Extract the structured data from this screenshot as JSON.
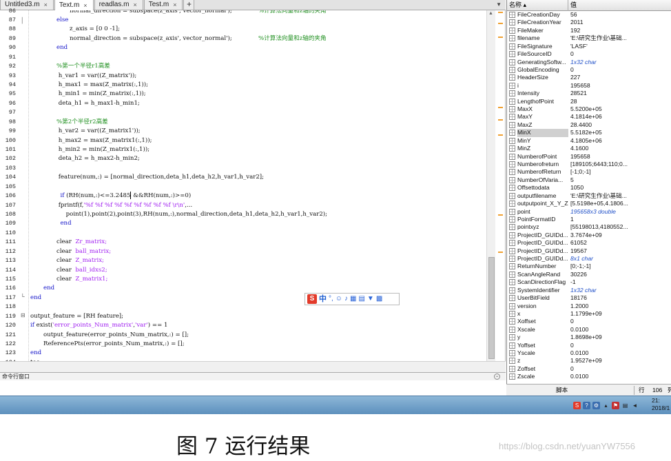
{
  "editor": {
    "tabs": [
      {
        "label": "Untitled3.m",
        "active": false
      },
      {
        "label": "Text.m",
        "active": true
      },
      {
        "label": "readlas.m",
        "active": false
      },
      {
        "label": "Test.m",
        "active": false
      }
    ],
    "tab_close": "×",
    "tab_add": "+",
    "lines": [
      {
        "n": "86",
        "indent": 3,
        "parts": [
          {
            "t": "normal_direction = subspace(z_axis', vector_normal');",
            "c": ""
          },
          {
            "t": "              %计算法向量和z轴的夹角",
            "c": "cm"
          }
        ]
      },
      {
        "n": "87",
        "indent": 2,
        "parts": [
          {
            "t": "else",
            "c": "kw"
          }
        ]
      },
      {
        "n": "88",
        "indent": 3,
        "parts": [
          {
            "t": "z_axis = [0 0 -1];",
            "c": ""
          }
        ]
      },
      {
        "n": "89",
        "indent": 3,
        "parts": [
          {
            "t": "normal_direction = subspace(z_axis', vector_normal');",
            "c": ""
          },
          {
            "t": "              %计算法向量和z轴的夹角",
            "c": "cm"
          }
        ]
      },
      {
        "n": "90",
        "indent": 2,
        "parts": [
          {
            "t": "end",
            "c": "kw"
          }
        ]
      },
      {
        "n": "91",
        "indent": 0,
        "parts": []
      },
      {
        "n": "92",
        "indent": 2,
        "parts": [
          {
            "t": "%第一个半径r1高差",
            "c": "cm"
          }
        ]
      },
      {
        "n": "93",
        "indent": 2,
        "parts": [
          {
            "t": " h_var1 = var((Z_matrix'));",
            "c": ""
          }
        ]
      },
      {
        "n": "94",
        "indent": 2,
        "parts": [
          {
            "t": " h_max1 = max(Z_matrix(:,1));",
            "c": ""
          }
        ]
      },
      {
        "n": "95",
        "indent": 2,
        "parts": [
          {
            "t": " h_min1 = min(Z_matrix(:,1));",
            "c": ""
          }
        ]
      },
      {
        "n": "96",
        "indent": 2,
        "parts": [
          {
            "t": " deta_h1 = h_max1-h_min1;",
            "c": ""
          }
        ]
      },
      {
        "n": "97",
        "indent": 0,
        "parts": []
      },
      {
        "n": "98",
        "indent": 2,
        "parts": [
          {
            "t": "%第2个半径r2高差",
            "c": "cm"
          }
        ]
      },
      {
        "n": "99",
        "indent": 2,
        "parts": [
          {
            "t": " h_var2 = var((Z_matrix1'));",
            "c": ""
          }
        ]
      },
      {
        "n": "100",
        "indent": 2,
        "parts": [
          {
            "t": " h_max2 = max(Z_matrix1(:,1));",
            "c": ""
          }
        ]
      },
      {
        "n": "101",
        "indent": 2,
        "parts": [
          {
            "t": " h_min2 = min(Z_matrix1(:,1));",
            "c": ""
          }
        ]
      },
      {
        "n": "102",
        "indent": 2,
        "parts": [
          {
            "t": " deta_h2 = h_max2-h_min2;",
            "c": ""
          }
        ]
      },
      {
        "n": "103",
        "indent": 0,
        "parts": []
      },
      {
        "n": "104",
        "indent": 2,
        "parts": [
          {
            "t": " feature(num,:) = [normal_direction,deta_h1,deta_h2,h_var1,h_var2];",
            "c": ""
          }
        ]
      },
      {
        "n": "105",
        "indent": 0,
        "parts": []
      },
      {
        "n": "106",
        "indent": 2,
        "parts": [
          {
            "t": "  ",
            "c": ""
          },
          {
            "t": "if",
            "c": "kw"
          },
          {
            "t": " (RH(num,:)<=3.2485",
            "c": ""
          },
          {
            "t": "|",
            "c": "cursor"
          },
          {
            "t": " &&RH(num,:)>=0)",
            "c": ""
          }
        ]
      },
      {
        "n": "107",
        "indent": 2,
        "parts": [
          {
            "t": " fprintf(f,",
            "c": ""
          },
          {
            "t": "'%f %f %f %f %f %f %f %f %f \\r\\n'",
            "c": "str"
          },
          {
            "t": ",...",
            "c": ""
          }
        ]
      },
      {
        "n": "108",
        "indent": 2,
        "parts": [
          {
            "t": "     point(1),point(2),point(3),RH(num,:),normal_direction,deta_h1,deta_h2,h_var1,h_var2);",
            "c": ""
          }
        ]
      },
      {
        "n": "109",
        "indent": 2,
        "parts": [
          {
            "t": "  ",
            "c": ""
          },
          {
            "t": "end",
            "c": "kw"
          }
        ]
      },
      {
        "n": "110",
        "indent": 0,
        "parts": []
      },
      {
        "n": "111",
        "indent": 2,
        "parts": [
          {
            "t": "clear  ",
            "c": ""
          },
          {
            "t": "Zr_matrix;",
            "c": "str"
          }
        ]
      },
      {
        "n": "112",
        "indent": 2,
        "parts": [
          {
            "t": "clear  ",
            "c": ""
          },
          {
            "t": "ball_matrix;",
            "c": "str"
          }
        ]
      },
      {
        "n": "113",
        "indent": 2,
        "parts": [
          {
            "t": "clear  ",
            "c": ""
          },
          {
            "t": "Z_matrix;",
            "c": "str"
          }
        ]
      },
      {
        "n": "114",
        "indent": 2,
        "parts": [
          {
            "t": "clear  ",
            "c": ""
          },
          {
            "t": "ball_idxs2;",
            "c": "str"
          }
        ]
      },
      {
        "n": "115",
        "indent": 2,
        "parts": [
          {
            "t": "clear  ",
            "c": ""
          },
          {
            "t": "Z_matrix1;",
            "c": "str"
          }
        ]
      },
      {
        "n": "116",
        "indent": 1,
        "parts": [
          {
            "t": "end",
            "c": "kw"
          }
        ]
      },
      {
        "n": "117",
        "indent": 0,
        "parts": [
          {
            "t": "end",
            "c": "kw"
          }
        ]
      },
      {
        "n": "118",
        "indent": 0,
        "parts": []
      },
      {
        "n": "119",
        "indent": 0,
        "parts": [
          {
            "t": "output_feature = [RH feature];",
            "c": ""
          }
        ]
      },
      {
        "n": "120",
        "indent": 0,
        "parts": [
          {
            "t": "if",
            "c": "kw"
          },
          {
            "t": " exist(",
            "c": ""
          },
          {
            "t": "'error_points_Num_matrix'",
            "c": "str"
          },
          {
            "t": ",",
            "c": ""
          },
          {
            "t": "'var'",
            "c": "str"
          },
          {
            "t": ") == 1",
            "c": ""
          }
        ]
      },
      {
        "n": "121",
        "indent": 1,
        "parts": [
          {
            "t": "output_feature(error_points_Num_matrix,:) = [];",
            "c": ""
          }
        ]
      },
      {
        "n": "122",
        "indent": 1,
        "parts": [
          {
            "t": "ReferencePts(error_points_Num_matrix,:) = [];",
            "c": ""
          }
        ]
      },
      {
        "n": "123",
        "indent": 0,
        "parts": [
          {
            "t": "end",
            "c": "kw"
          }
        ]
      },
      {
        "n": "124",
        "indent": 0,
        "parts": [
          {
            "t": "toc;",
            "c": ""
          }
        ]
      }
    ]
  },
  "command_window": {
    "title": "命令行窗口"
  },
  "ime": {
    "logo": "S",
    "mode": "中"
  },
  "workspace": {
    "header_name": "名称 ▴",
    "header_value": "值",
    "rows": [
      {
        "name": "FileCreationDay",
        "value": "56",
        "italic": false
      },
      {
        "name": "FileCreationYear",
        "value": "2011",
        "italic": false
      },
      {
        "name": "FileMaker",
        "value": "192",
        "italic": false
      },
      {
        "name": "filename",
        "value": "'E:\\研究生作业\\基础...",
        "italic": false
      },
      {
        "name": "FileSignature",
        "value": "'LASF'",
        "italic": false
      },
      {
        "name": "FileSourceID",
        "value": "0",
        "italic": false
      },
      {
        "name": "GeneratingSoftw...",
        "value": "1x32 char",
        "italic": true
      },
      {
        "name": "GlobalEncoding",
        "value": "0",
        "italic": false
      },
      {
        "name": "HeaderSize",
        "value": "227",
        "italic": false
      },
      {
        "name": "i",
        "value": "195658",
        "italic": false
      },
      {
        "name": "Intensity",
        "value": "28521",
        "italic": false
      },
      {
        "name": "LengthofPoint",
        "value": "28",
        "italic": false
      },
      {
        "name": "MaxX",
        "value": "5.5200e+05",
        "italic": false
      },
      {
        "name": "MaxY",
        "value": "4.1814e+06",
        "italic": false
      },
      {
        "name": "MaxZ",
        "value": "28.4400",
        "italic": false
      },
      {
        "name": "MinX",
        "value": "5.5182e+05",
        "italic": false,
        "selected": true
      },
      {
        "name": "MinY",
        "value": "4.1805e+06",
        "italic": false
      },
      {
        "name": "MinZ",
        "value": "4.1600",
        "italic": false
      },
      {
        "name": "NumberofPoint",
        "value": "195658",
        "italic": false
      },
      {
        "name": "Numberofreturn",
        "value": "[189105;6443;110;0...",
        "italic": false
      },
      {
        "name": "NumberofReturn",
        "value": "[-1;0;-1]",
        "italic": false
      },
      {
        "name": "NumberOfVaria...",
        "value": "5",
        "italic": false
      },
      {
        "name": "Offsettodata",
        "value": "1050",
        "italic": false
      },
      {
        "name": "outputfilename",
        "value": "'E:\\研究生作业\\基础...",
        "italic": false
      },
      {
        "name": "outputpoint_X_Y_Z",
        "value": "[5.5198e+05,4.1806...",
        "italic": false
      },
      {
        "name": "point",
        "value": "195658x3 double",
        "italic": true
      },
      {
        "name": "PointFormatID",
        "value": "1",
        "italic": false
      },
      {
        "name": "pointxyz",
        "value": "[55198013,4180552...",
        "italic": false
      },
      {
        "name": "ProjectID_GUIDd...",
        "value": "3.7674e+09",
        "italic": false
      },
      {
        "name": "ProjectID_GUIDd...",
        "value": "61052",
        "italic": false
      },
      {
        "name": "ProjectID_GUIDd...",
        "value": "19567",
        "italic": false
      },
      {
        "name": "ProjectID_GUIDd...",
        "value": "8x1 char",
        "italic": true
      },
      {
        "name": "ReturnNumber",
        "value": "[0;-1;-1]",
        "italic": false
      },
      {
        "name": "ScanAngleRand",
        "value": "30226",
        "italic": false
      },
      {
        "name": "ScanDirectionFlag",
        "value": "-1",
        "italic": false
      },
      {
        "name": "SystemIdentifier",
        "value": "1x32 char",
        "italic": true
      },
      {
        "name": "UserBitField",
        "value": "18176",
        "italic": false
      },
      {
        "name": "version",
        "value": "1.2000",
        "italic": false
      },
      {
        "name": "x",
        "value": "1.1799e+09",
        "italic": false
      },
      {
        "name": "Xoffset",
        "value": "0",
        "italic": false
      },
      {
        "name": "Xscale",
        "value": "0.0100",
        "italic": false
      },
      {
        "name": "y",
        "value": "1.8698e+09",
        "italic": false
      },
      {
        "name": "Yoffset",
        "value": "0",
        "italic": false
      },
      {
        "name": "Yscale",
        "value": "0.0100",
        "italic": false
      },
      {
        "name": "z",
        "value": "1.9527e+09",
        "italic": false
      },
      {
        "name": "Zoffset",
        "value": "0",
        "italic": false
      },
      {
        "name": "Zscale",
        "value": "0.0100",
        "italic": false
      }
    ]
  },
  "status": {
    "script": "脚本",
    "row_label": "行",
    "row_value": "106",
    "col_label": "列"
  },
  "taskbar": {
    "clock_time": "21:",
    "clock_date": "2018/1"
  },
  "caption": "图 7 运行结果",
  "watermark": "https://blog.csdn.net/yuanYW7556"
}
